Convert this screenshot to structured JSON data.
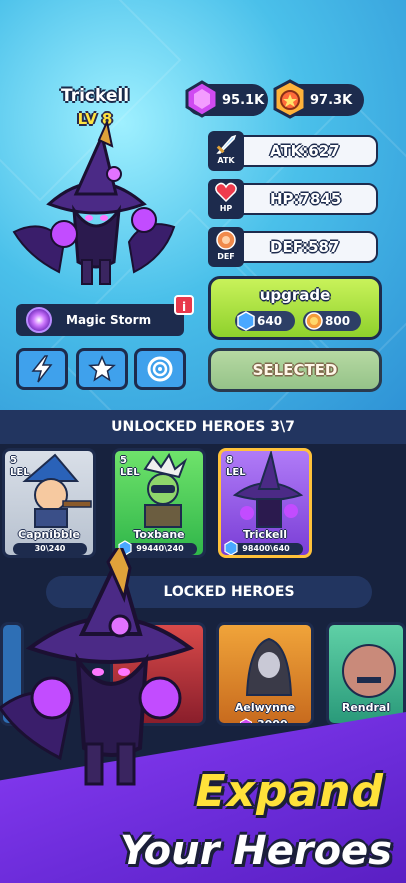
{
  "hero": {
    "name": "Trickell",
    "level": "LV 8"
  },
  "currencies": {
    "gems": "95.1K",
    "trophies": "97.3K"
  },
  "stats": {
    "atk_label": "ATK",
    "atk": "ATK:627",
    "hp_label": "HP",
    "hp": "HP:7845",
    "def_label": "DEF",
    "def": "DEF:587"
  },
  "skill": {
    "name": "Magic Storm",
    "info": "i"
  },
  "upgrade": {
    "label": "upgrade",
    "cost_crystals": "640",
    "cost_gold": "800"
  },
  "selected_label": "SELECTED",
  "unlocked": {
    "title": "UNLOCKED HEROES 3\\7"
  },
  "unlocked_cards": [
    {
      "level": "5",
      "lv_tag": "LEL",
      "name": "Capnibble",
      "progress": "30\\240"
    },
    {
      "level": "5",
      "lv_tag": "LEL",
      "name": "Toxbane",
      "progress": "99440\\240"
    },
    {
      "level": "8",
      "lv_tag": "LEL",
      "name": "Trickell",
      "progress": "98400\\640"
    }
  ],
  "locked": {
    "title": "LOCKED HEROES"
  },
  "locked_cards": [
    {
      "name": "Aelwynne",
      "price": "3000"
    },
    {
      "name": "Rendral",
      "price": ""
    }
  ],
  "banner": {
    "line1": "Expand",
    "line2": "Your Heroes"
  },
  "colors": {
    "accent": "#1d2b4d",
    "upgrade_green": "#a7e13f",
    "purple": "#7a35ea",
    "sky": "#4ac0ea"
  }
}
